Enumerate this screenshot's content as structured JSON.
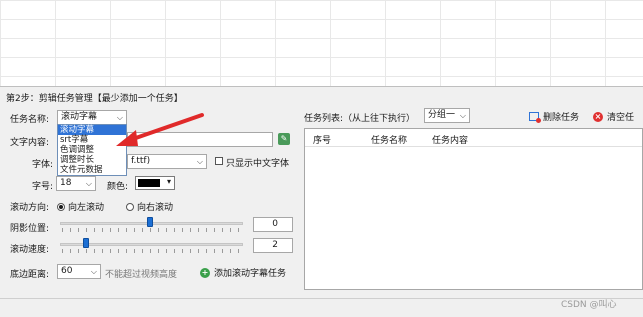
{
  "step2": {
    "title": "第2步：剪辑任务管理【最少添加一个任务】",
    "task_name_label": "任务名称:",
    "task_name_value": "滚动字幕",
    "task_options": [
      "滚动字幕",
      "srt字幕",
      "色调调整",
      "调整时长",
      "文件元数据"
    ],
    "text_label": "文字内容:",
    "font_label": "字体:",
    "font_value": "f.ttf)",
    "chinese_only_label": "只显示中文字体",
    "size_label": "字号:",
    "size_value": "18",
    "color_label": "颜色:",
    "color_swatch": "#000000",
    "direction_label": "滚动方向:",
    "dir_left": "向左滚动",
    "dir_right": "向右滚动",
    "shadow_label": "阴影位置:",
    "shadow_value": "0",
    "shadow_level": 0.49,
    "speed_label": "滚动速度:",
    "speed_value": "2",
    "speed_level": 0.13,
    "bottom_label": "底边距离:",
    "bottom_value": "60",
    "bottom_hint": "不能超过视频高度",
    "add_task_button": "添加滚动字幕任务"
  },
  "task_list": {
    "label": "任务列表:（从上往下执行）",
    "group_value": "分组一",
    "delete_button": "删除任务",
    "clear_button": "清空任",
    "columns": [
      "序号",
      "任务名称",
      "任务内容"
    ]
  },
  "watermark": "CSDN @叫心",
  "colors": {
    "accent": "#2f73d6",
    "arrow": "#e02a2a",
    "delete_icon": "#2f73d6",
    "clear_icon": "#e03030",
    "add_icon": "#3aa04a"
  }
}
